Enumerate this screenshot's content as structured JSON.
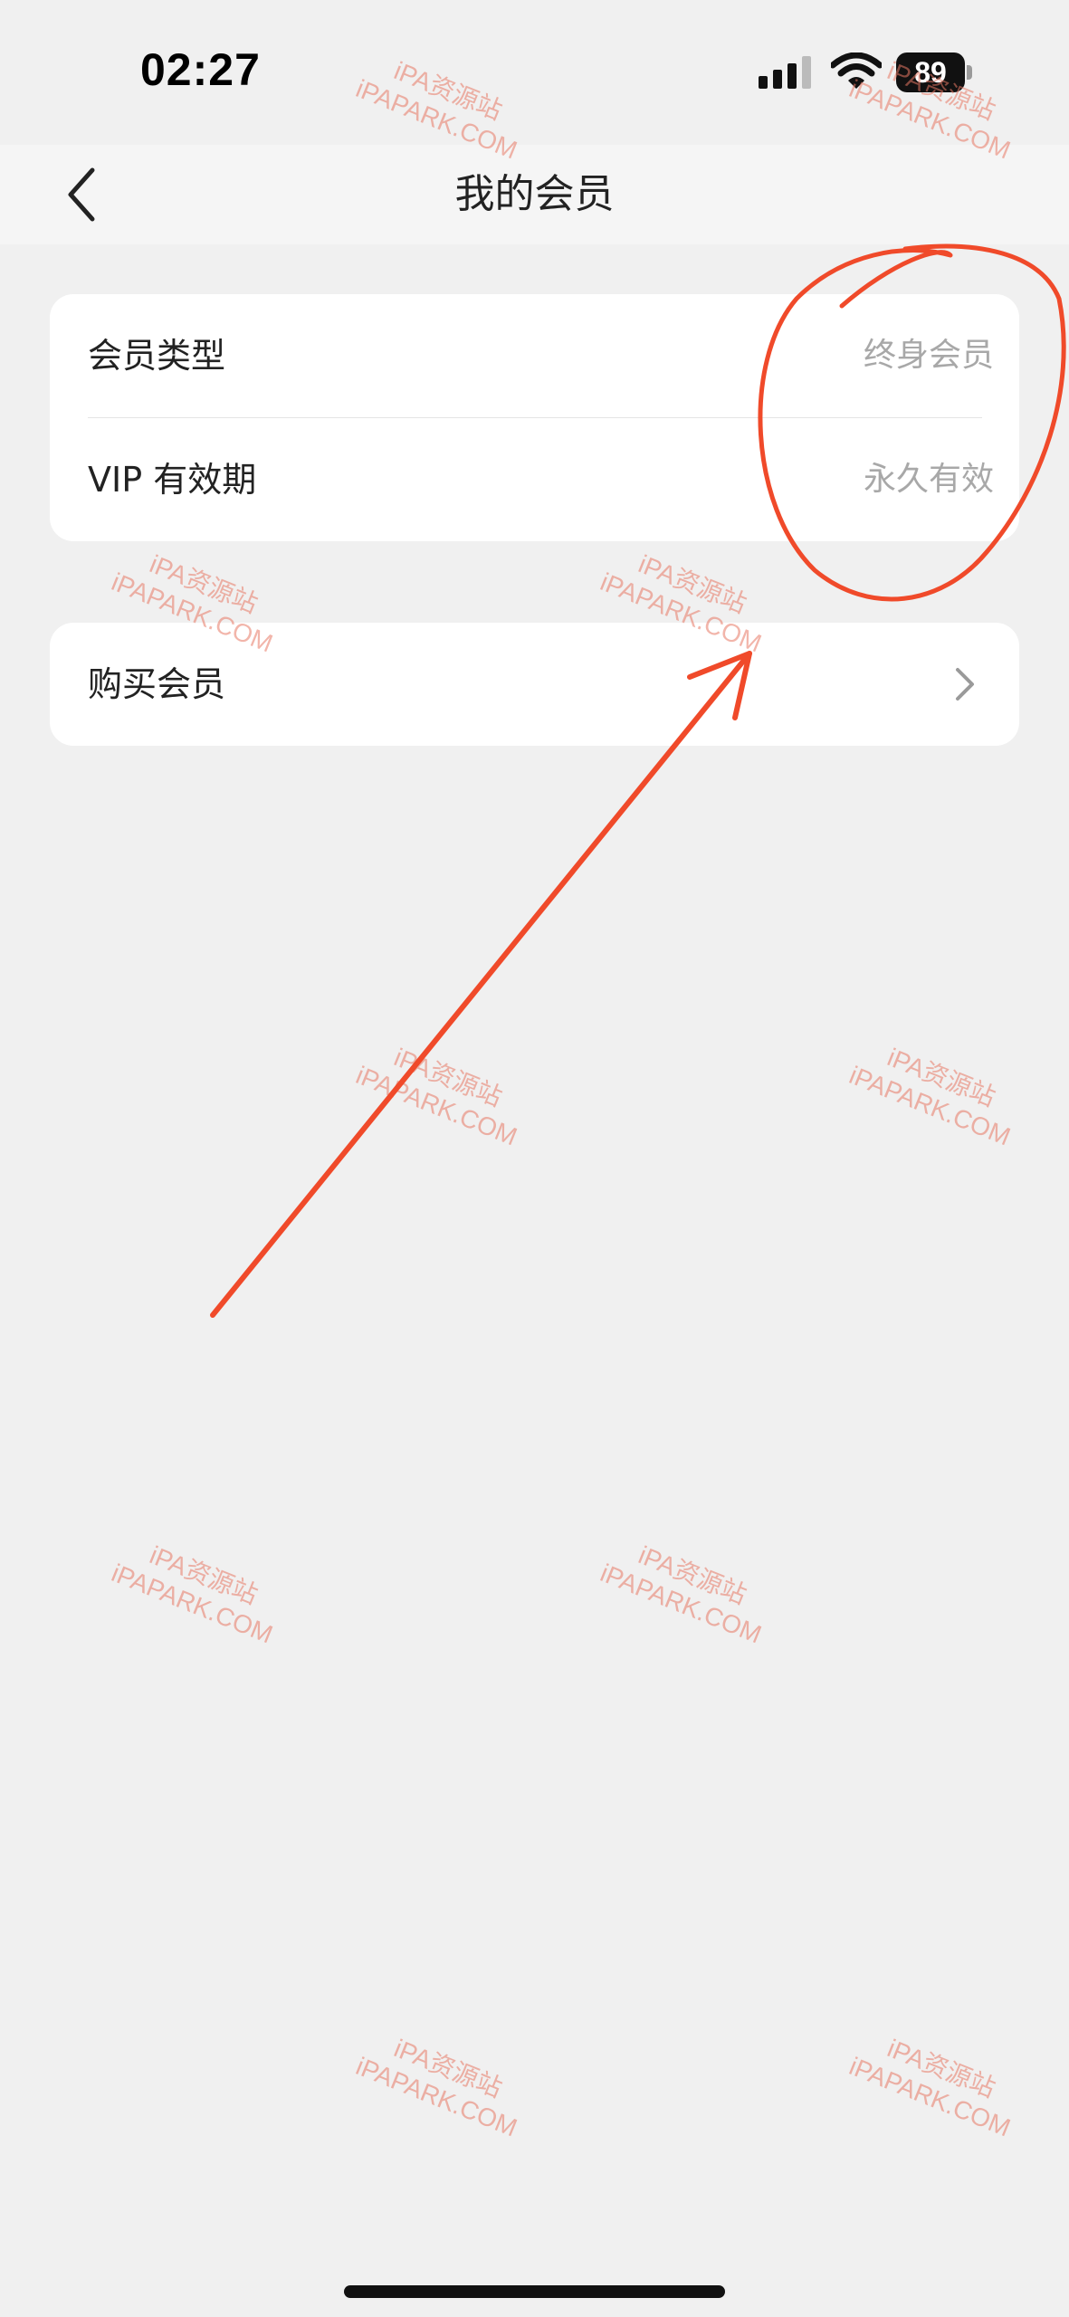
{
  "status_bar": {
    "time": "02:27",
    "battery_level": "89",
    "icons": [
      "signal-icon",
      "wifi-icon",
      "battery-icon"
    ]
  },
  "nav": {
    "title": "我的会员",
    "back_icon": "chevron-left-icon"
  },
  "membership_info": {
    "rows": [
      {
        "label": "会员类型",
        "value": "终身会员"
      },
      {
        "label": "VIP 有效期",
        "value": "永久有效"
      }
    ]
  },
  "buy_membership": {
    "label": "购买会员",
    "icon": "chevron-right-icon"
  },
  "watermark": {
    "line1": "iPA资源站",
    "line2": "iPAPARK.COM"
  },
  "colors": {
    "background": "#f0f0f0",
    "card": "#ffffff",
    "annotation": "#f04a2a",
    "watermark": "#e87864",
    "value_text": "#a8a8a8"
  }
}
